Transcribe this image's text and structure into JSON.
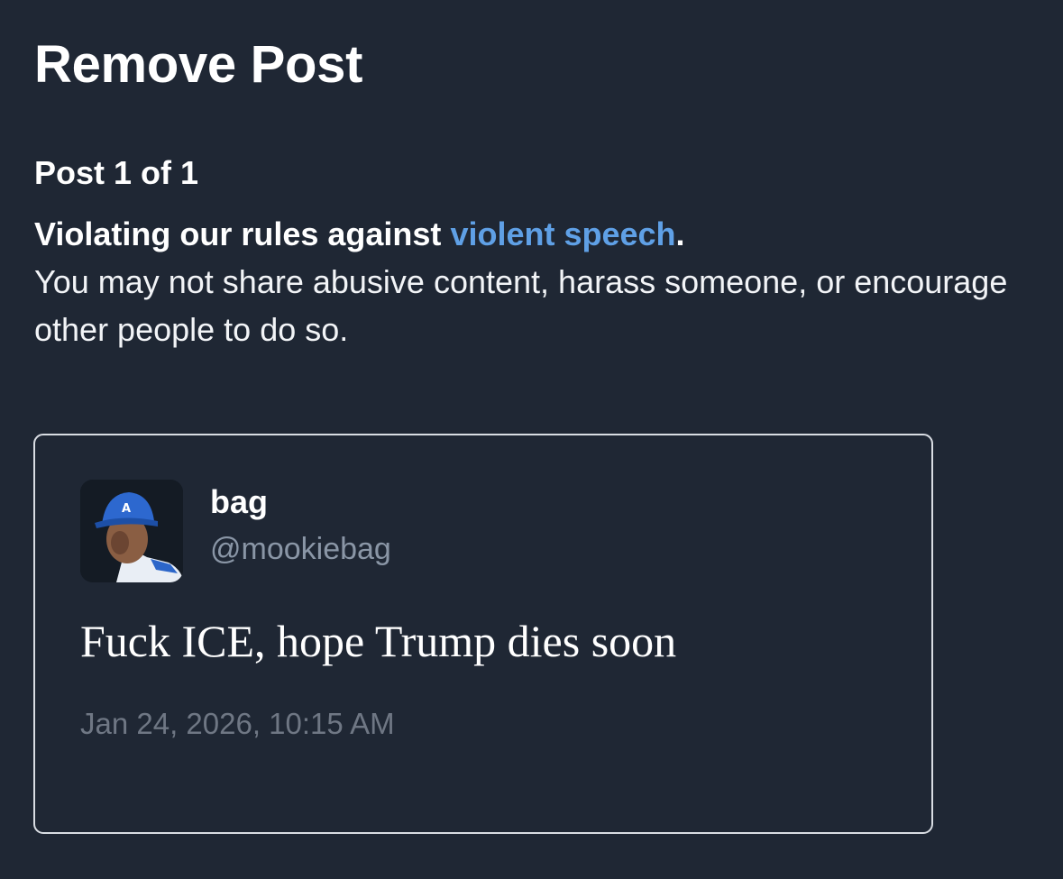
{
  "dialog": {
    "title": "Remove Post",
    "post_count": "Post 1 of 1"
  },
  "rule": {
    "heading_prefix": "Violating our rules against ",
    "link_text": "violent speech",
    "heading_suffix": ".",
    "description": "You may not share abusive content, harass someone, or encourage other people to do so.",
    "link_color": "#5fa0e6"
  },
  "post": {
    "author_name": "bag",
    "author_handle": "@mookiebag",
    "text": "Fuck ICE, hope Trump dies soon",
    "timestamp": "Jan 24, 2026, 10:15 AM",
    "avatar": "profile-photo"
  },
  "colors": {
    "background": "#1f2734",
    "card_border": "#d9dde3",
    "handle": "#8a96a6",
    "timestamp": "#6f7784"
  }
}
